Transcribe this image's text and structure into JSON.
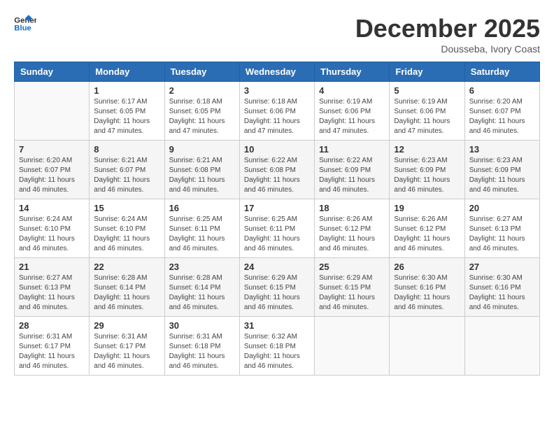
{
  "header": {
    "logo_line1": "General",
    "logo_line2": "Blue",
    "month_year": "December 2025",
    "location": "Dousseba, Ivory Coast"
  },
  "weekdays": [
    "Sunday",
    "Monday",
    "Tuesday",
    "Wednesday",
    "Thursday",
    "Friday",
    "Saturday"
  ],
  "weeks": [
    [
      {
        "day": "",
        "sunrise": "",
        "sunset": "",
        "daylight": ""
      },
      {
        "day": "1",
        "sunrise": "6:17 AM",
        "sunset": "6:05 PM",
        "daylight": "11 hours and 47 minutes."
      },
      {
        "day": "2",
        "sunrise": "6:18 AM",
        "sunset": "6:05 PM",
        "daylight": "11 hours and 47 minutes."
      },
      {
        "day": "3",
        "sunrise": "6:18 AM",
        "sunset": "6:06 PM",
        "daylight": "11 hours and 47 minutes."
      },
      {
        "day": "4",
        "sunrise": "6:19 AM",
        "sunset": "6:06 PM",
        "daylight": "11 hours and 47 minutes."
      },
      {
        "day": "5",
        "sunrise": "6:19 AM",
        "sunset": "6:06 PM",
        "daylight": "11 hours and 47 minutes."
      },
      {
        "day": "6",
        "sunrise": "6:20 AM",
        "sunset": "6:07 PM",
        "daylight": "11 hours and 46 minutes."
      }
    ],
    [
      {
        "day": "7",
        "sunrise": "6:20 AM",
        "sunset": "6:07 PM",
        "daylight": "11 hours and 46 minutes."
      },
      {
        "day": "8",
        "sunrise": "6:21 AM",
        "sunset": "6:07 PM",
        "daylight": "11 hours and 46 minutes."
      },
      {
        "day": "9",
        "sunrise": "6:21 AM",
        "sunset": "6:08 PM",
        "daylight": "11 hours and 46 minutes."
      },
      {
        "day": "10",
        "sunrise": "6:22 AM",
        "sunset": "6:08 PM",
        "daylight": "11 hours and 46 minutes."
      },
      {
        "day": "11",
        "sunrise": "6:22 AM",
        "sunset": "6:09 PM",
        "daylight": "11 hours and 46 minutes."
      },
      {
        "day": "12",
        "sunrise": "6:23 AM",
        "sunset": "6:09 PM",
        "daylight": "11 hours and 46 minutes."
      },
      {
        "day": "13",
        "sunrise": "6:23 AM",
        "sunset": "6:09 PM",
        "daylight": "11 hours and 46 minutes."
      }
    ],
    [
      {
        "day": "14",
        "sunrise": "6:24 AM",
        "sunset": "6:10 PM",
        "daylight": "11 hours and 46 minutes."
      },
      {
        "day": "15",
        "sunrise": "6:24 AM",
        "sunset": "6:10 PM",
        "daylight": "11 hours and 46 minutes."
      },
      {
        "day": "16",
        "sunrise": "6:25 AM",
        "sunset": "6:11 PM",
        "daylight": "11 hours and 46 minutes."
      },
      {
        "day": "17",
        "sunrise": "6:25 AM",
        "sunset": "6:11 PM",
        "daylight": "11 hours and 46 minutes."
      },
      {
        "day": "18",
        "sunrise": "6:26 AM",
        "sunset": "6:12 PM",
        "daylight": "11 hours and 46 minutes."
      },
      {
        "day": "19",
        "sunrise": "6:26 AM",
        "sunset": "6:12 PM",
        "daylight": "11 hours and 46 minutes."
      },
      {
        "day": "20",
        "sunrise": "6:27 AM",
        "sunset": "6:13 PM",
        "daylight": "11 hours and 46 minutes."
      }
    ],
    [
      {
        "day": "21",
        "sunrise": "6:27 AM",
        "sunset": "6:13 PM",
        "daylight": "11 hours and 46 minutes."
      },
      {
        "day": "22",
        "sunrise": "6:28 AM",
        "sunset": "6:14 PM",
        "daylight": "11 hours and 46 minutes."
      },
      {
        "day": "23",
        "sunrise": "6:28 AM",
        "sunset": "6:14 PM",
        "daylight": "11 hours and 46 minutes."
      },
      {
        "day": "24",
        "sunrise": "6:29 AM",
        "sunset": "6:15 PM",
        "daylight": "11 hours and 46 minutes."
      },
      {
        "day": "25",
        "sunrise": "6:29 AM",
        "sunset": "6:15 PM",
        "daylight": "11 hours and 46 minutes."
      },
      {
        "day": "26",
        "sunrise": "6:30 AM",
        "sunset": "6:16 PM",
        "daylight": "11 hours and 46 minutes."
      },
      {
        "day": "27",
        "sunrise": "6:30 AM",
        "sunset": "6:16 PM",
        "daylight": "11 hours and 46 minutes."
      }
    ],
    [
      {
        "day": "28",
        "sunrise": "6:31 AM",
        "sunset": "6:17 PM",
        "daylight": "11 hours and 46 minutes."
      },
      {
        "day": "29",
        "sunrise": "6:31 AM",
        "sunset": "6:17 PM",
        "daylight": "11 hours and 46 minutes."
      },
      {
        "day": "30",
        "sunrise": "6:31 AM",
        "sunset": "6:18 PM",
        "daylight": "11 hours and 46 minutes."
      },
      {
        "day": "31",
        "sunrise": "6:32 AM",
        "sunset": "6:18 PM",
        "daylight": "11 hours and 46 minutes."
      },
      {
        "day": "",
        "sunrise": "",
        "sunset": "",
        "daylight": ""
      },
      {
        "day": "",
        "sunrise": "",
        "sunset": "",
        "daylight": ""
      },
      {
        "day": "",
        "sunrise": "",
        "sunset": "",
        "daylight": ""
      }
    ]
  ]
}
